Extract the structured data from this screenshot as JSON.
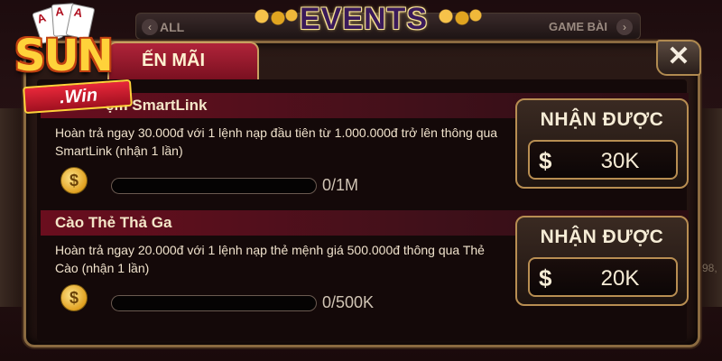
{
  "header": {
    "title": "EVENTS",
    "tab_all": "ALL",
    "tab_game_bai": "GAME BÀI",
    "chevron_left": "‹",
    "chevron_right": "›"
  },
  "logo": {
    "brand_text": "SUN",
    "sub_text": ".Win",
    "card_labels": [
      "A",
      "A",
      "A"
    ]
  },
  "panel": {
    "active_tab": "ẾN MÃI",
    "close_symbol": "✕"
  },
  "events": [
    {
      "title": "ệm SmartLink",
      "description": "Hoàn trả ngay 30.000đ với 1 lệnh nạp đầu tiên từ 1.000.000đ trở lên thông qua SmartLink (nhận 1 lần)",
      "progress_text": "0/1M",
      "progress_fraction": 0,
      "reward_label": "NHẬN ĐƯỢC",
      "reward_currency": "$",
      "reward_value": "30K"
    },
    {
      "title": "Cào Thẻ Thả Ga",
      "description": "Hoàn trả ngay 20.000đ với 1 lệnh nạp thẻ mệnh giá 500.000đ thông qua Thẻ Cào (nhận 1 lần)",
      "progress_text": "0/500K",
      "progress_fraction": 0,
      "reward_label": "NHẬN ĐƯỢC",
      "reward_currency": "$",
      "reward_value": "20K"
    }
  ],
  "background": {
    "right_edge_text": "98,"
  },
  "colors": {
    "accent_gold": "#b88e52",
    "tab_red": "#b0243a",
    "row_title_red": "#6a0e1e",
    "text_cream": "#f6ecd6"
  }
}
